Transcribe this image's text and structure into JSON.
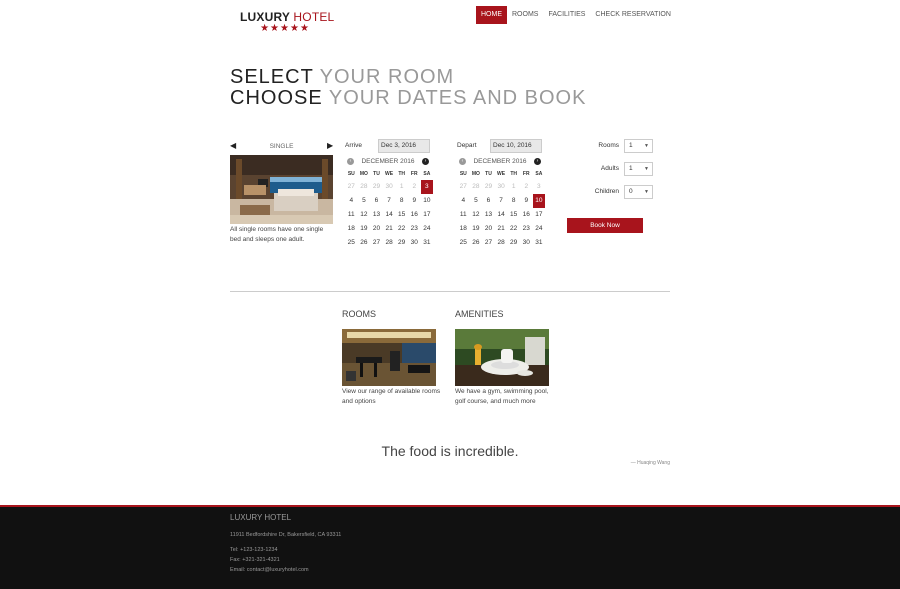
{
  "brand": {
    "name_main": "LUXURY",
    "name_accent": "HOTEL",
    "stars": "★★★★★"
  },
  "nav": [
    {
      "label": "HOME",
      "active": true
    },
    {
      "label": "ROOMS"
    },
    {
      "label": "FACILITIES"
    },
    {
      "label": "CHECK RESERVATION"
    }
  ],
  "headline": {
    "line1_dark": "SELECT",
    "line1_light": "YOUR ROOM",
    "line2_dark": "CHOOSE",
    "line2_light": "YOUR DATES AND BOOK"
  },
  "room": {
    "type": "SINGLE",
    "description": "All single rooms have one single bed and sleeps one adult."
  },
  "arrive": {
    "label": "Arrive",
    "value": "Dec 3, 2016",
    "month": "DECEMBER 2016",
    "dow": [
      "SU",
      "MO",
      "TU",
      "WE",
      "TH",
      "FR",
      "SA"
    ],
    "days": [
      "27",
      "28",
      "29",
      "30",
      "1",
      "2",
      "3",
      "4",
      "5",
      "6",
      "7",
      "8",
      "9",
      "10",
      "11",
      "12",
      "13",
      "14",
      "15",
      "16",
      "17",
      "18",
      "19",
      "20",
      "21",
      "22",
      "23",
      "24",
      "25",
      "26",
      "27",
      "28",
      "29",
      "30",
      "31"
    ]
  },
  "depart": {
    "label": "Depart",
    "value": "Dec 10, 2016",
    "month": "DECEMBER 2016",
    "dow": [
      "SU",
      "MO",
      "TU",
      "WE",
      "TH",
      "FR",
      "SA"
    ],
    "days": [
      "27",
      "28",
      "29",
      "30",
      "1",
      "2",
      "3",
      "4",
      "5",
      "6",
      "7",
      "8",
      "9",
      "10",
      "11",
      "12",
      "13",
      "14",
      "15",
      "16",
      "17",
      "18",
      "19",
      "20",
      "21",
      "22",
      "23",
      "24",
      "25",
      "26",
      "27",
      "28",
      "29",
      "30",
      "31"
    ]
  },
  "selectors": {
    "rooms_label": "Rooms",
    "rooms_value": "1",
    "adults_label": "Adults",
    "adults_value": "1",
    "children_label": "Children",
    "children_value": "0"
  },
  "book_label": "Book Now",
  "features": {
    "rooms_title": "ROOMS",
    "rooms_desc": "View our range of available rooms and options",
    "amenities_title": "AMENITIES",
    "amenities_desc": "We have a gym, swimming pool, golf course, and much more"
  },
  "testimonial": {
    "quote": "The food is incredible.",
    "author": "— Huaqing Wang"
  },
  "footer": {
    "title": "LUXURY HOTEL",
    "address": "11911 Bedfordshire Dr, Bakersfield, CA 93311",
    "tel": "Tel: +123-123-1234",
    "fax": "Fax: +321-321-4321",
    "email": "Email: contact@luxuryhotel.com"
  },
  "colors": {
    "accent": "#a8141c",
    "footer_bg": "#111111"
  }
}
